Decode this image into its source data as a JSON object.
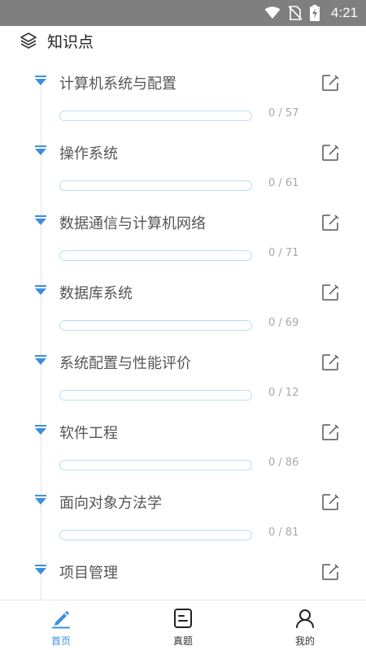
{
  "status_bar": {
    "time": "4:21",
    "icons": [
      "wifi-icon",
      "no-sim-icon",
      "battery-charging-icon"
    ]
  },
  "header": {
    "title": "知识点",
    "icon": "layers-icon"
  },
  "items": [
    {
      "title": "计算机系统与配置",
      "count": "0 / 57",
      "progress": 0
    },
    {
      "title": "操作系统",
      "count": "0 / 61",
      "progress": 0
    },
    {
      "title": "数据通信与计算机网络",
      "count": "0 / 71",
      "progress": 0
    },
    {
      "title": "数据库系统",
      "count": "0 / 69",
      "progress": 0
    },
    {
      "title": "系统配置与性能评价",
      "count": "0 / 12",
      "progress": 0
    },
    {
      "title": "软件工程",
      "count": "0 / 86",
      "progress": 0
    },
    {
      "title": "面向对象方法学",
      "count": "0 / 81",
      "progress": 0
    },
    {
      "title": "项目管理",
      "count": "",
      "progress": 0
    }
  ],
  "tab_bar": {
    "tabs": [
      {
        "label": "首页",
        "icon": "pencil-icon",
        "active": true
      },
      {
        "label": "真题",
        "icon": "paper-icon",
        "active": false
      },
      {
        "label": "我的",
        "icon": "user-icon",
        "active": false
      }
    ]
  },
  "colors": {
    "accent": "#3d8ee0",
    "status_bar": "#7f7f7f",
    "progress_border": "#b9ddf3",
    "count_text": "#a8a8a8"
  }
}
